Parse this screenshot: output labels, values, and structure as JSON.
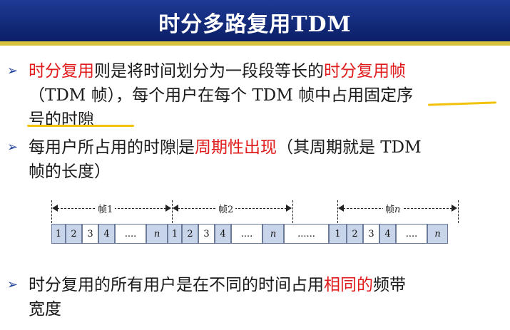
{
  "title": "时分多路复用TDM",
  "bullets": [
    {
      "lines": [
        [
          {
            "t": "时分复用",
            "c": "red"
          },
          {
            "t": "则是将时间划分为一段段等长的"
          },
          {
            "t": "时分复用帧",
            "c": "red"
          }
        ],
        [
          {
            "t": "（TDM 帧），每个用户在每个 TDM 帧中占用固定序"
          }
        ],
        [
          {
            "t": "号的时隙"
          }
        ]
      ]
    },
    {
      "lines": [
        [
          {
            "t": "每用户所占用的时隙"
          },
          {
            "t": "是"
          },
          {
            "t": "周期性出现",
            "c": "red"
          },
          {
            "t": "（其周期就是 TDM"
          }
        ],
        [
          {
            "t": "帧的长度）"
          }
        ]
      ]
    },
    {
      "lines": [
        [
          {
            "t": "时分复用的所有用户是在不同的时间占用"
          },
          {
            "t": "相同的",
            "c": "red"
          },
          {
            "t": "频带"
          }
        ],
        [
          {
            "t": "宽度"
          }
        ]
      ]
    }
  ],
  "bullet_marker": "➢",
  "diagram": {
    "frames": [
      {
        "label_prefix": "帧",
        "label_num": "1"
      },
      {
        "label_prefix": "帧",
        "label_num": "2"
      },
      {
        "label_prefix": "帧",
        "label_num": "n"
      }
    ],
    "slots": [
      {
        "text": "1",
        "shade": true
      },
      {
        "text": "2",
        "shade": true
      },
      {
        "text": "3",
        "shade": false
      },
      {
        "text": "4",
        "shade": true
      },
      {
        "text": "....",
        "shade": false
      },
      {
        "text": "n",
        "shade": true,
        "italic": true
      },
      {
        "text": "1",
        "shade": true
      },
      {
        "text": "2",
        "shade": true
      },
      {
        "text": "3",
        "shade": false
      },
      {
        "text": "4",
        "shade": true
      },
      {
        "text": "....",
        "shade": false
      },
      {
        "text": "n",
        "shade": true,
        "italic": true
      },
      {
        "text": "......",
        "shade": false
      },
      {
        "text": "1",
        "shade": true
      },
      {
        "text": "2",
        "shade": true
      },
      {
        "text": "3",
        "shade": false
      },
      {
        "text": "4",
        "shade": true
      },
      {
        "text": "....",
        "shade": false
      },
      {
        "text": "n",
        "shade": true,
        "italic": true
      }
    ]
  }
}
